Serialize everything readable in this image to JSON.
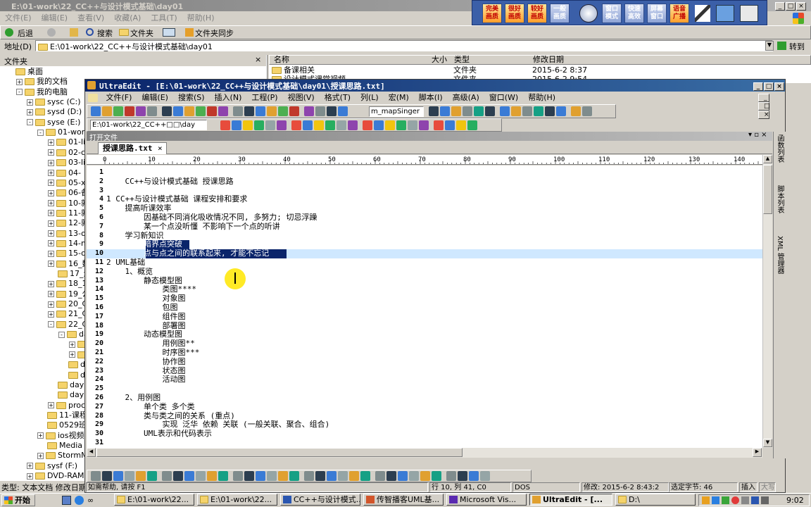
{
  "explorer": {
    "title": "E:\\01-work\\22_CC++与设计模式基础\\day01",
    "menu": [
      "文件(E)",
      "编辑(E)",
      "查看(V)",
      "收藏(A)",
      "工具(T)",
      "帮助(H)"
    ],
    "toolbar": {
      "back": "后退",
      "search": "搜索",
      "folders": "文件夹",
      "sync": "文件夹同步"
    },
    "address_label": "地址(D)",
    "address_value": "E:\\01-work\\22_CC++与设计模式基础\\day01",
    "go_label": "转到",
    "pane_title": "文件夹",
    "tree": [
      {
        "label": "桌面",
        "indent": 0,
        "exp": ""
      },
      {
        "label": "我的文档",
        "indent": 1,
        "exp": "+"
      },
      {
        "label": "我的电脑",
        "indent": 1,
        "exp": "-"
      },
      {
        "label": "sysc (C:)",
        "indent": 2,
        "exp": "+"
      },
      {
        "label": "sysd (D:)",
        "indent": 2,
        "exp": "+"
      },
      {
        "label": "syse (E:)",
        "indent": 2,
        "exp": "-"
      },
      {
        "label": "01-work",
        "indent": 3,
        "exp": "-"
      },
      {
        "label": "01-lin",
        "indent": 4,
        "exp": "+"
      },
      {
        "label": "02-c课",
        "indent": 4,
        "exp": "+"
      },
      {
        "label": "03-lin",
        "indent": 4,
        "exp": "+"
      },
      {
        "label": "04-",
        "indent": 4,
        "exp": "+"
      },
      {
        "label": "05-xun",
        "indent": 4,
        "exp": "+"
      },
      {
        "label": "06-备语",
        "indent": 4,
        "exp": "+"
      },
      {
        "label": "10-就业",
        "indent": 4,
        "exp": "+"
      },
      {
        "label": "11-就业",
        "indent": 4,
        "exp": "+"
      },
      {
        "label": "12-就业",
        "indent": 4,
        "exp": "+"
      },
      {
        "label": "13-otb",
        "indent": 4,
        "exp": "+"
      },
      {
        "label": "14-mys",
        "indent": 4,
        "exp": "+"
      },
      {
        "label": "15-ora",
        "indent": 4,
        "exp": "+"
      },
      {
        "label": "16_数据",
        "indent": 4,
        "exp": "+"
      },
      {
        "label": "17_演补",
        "indent": 4,
        "exp": ""
      },
      {
        "label": "18_111",
        "indent": 4,
        "exp": "+"
      },
      {
        "label": "19_公开",
        "indent": 4,
        "exp": "+"
      },
      {
        "label": "20_C提",
        "indent": 4,
        "exp": "+"
      },
      {
        "label": "21_CPl",
        "indent": 4,
        "exp": "+"
      },
      {
        "label": "22_CC+",
        "indent": 4,
        "exp": "-"
      },
      {
        "label": "day",
        "indent": 5,
        "exp": "-"
      },
      {
        "label": "",
        "indent": 6,
        "exp": "+"
      },
      {
        "label": "",
        "indent": 6,
        "exp": "+"
      },
      {
        "label": "day",
        "indent": 5,
        "exp": ""
      },
      {
        "label": "day",
        "indent": 5,
        "exp": ""
      },
      {
        "label": "day08",
        "indent": 4,
        "exp": ""
      },
      {
        "label": "day11",
        "indent": 4,
        "exp": ""
      },
      {
        "label": "proc网",
        "indent": 4,
        "exp": "+"
      },
      {
        "label": "11-课程框",
        "indent": 3,
        "exp": ""
      },
      {
        "label": "0529班",
        "indent": 3,
        "exp": ""
      },
      {
        "label": "ios视频",
        "indent": 3,
        "exp": "+"
      },
      {
        "label": "Media",
        "indent": 3,
        "exp": ""
      },
      {
        "label": "StormMedi",
        "indent": 3,
        "exp": "+"
      },
      {
        "label": "sysf (F:)",
        "indent": 2,
        "exp": "+"
      },
      {
        "label": "DVD-RAM 驱动",
        "indent": 2,
        "exp": "+"
      }
    ],
    "list_headers": [
      "名称",
      "大小",
      "类型",
      "修改日期"
    ],
    "list_rows": [
      {
        "name": "备课相关",
        "size": "",
        "type": "文件夹",
        "date": "2015-6-2 8:37"
      },
      {
        "name": "设计模式课堂视频",
        "size": "",
        "type": "文件夹",
        "date": "2015-6-2 9:54"
      }
    ],
    "status_left": "类型: 文本文档 修改日期"
  },
  "quick_launch": [
    {
      "label": "完美\n画质"
    },
    {
      "label": "很好\n画质"
    },
    {
      "label": "较好\n画质"
    },
    {
      "label": "一般\n画质"
    },
    {
      "label": "窗口\n模式"
    },
    {
      "label": "快速\n高效"
    },
    {
      "label": "屏幕\n窗口"
    },
    {
      "label": "语音\n广播"
    }
  ],
  "ultraedit": {
    "title": "UltraEdit - [E:\\01-work\\22_CC++与设计模式基础\\day01\\授课思路.txt]",
    "menu": [
      "文件(F)",
      "编辑(E)",
      "搜索(S)",
      "插入(N)",
      "工程(P)",
      "视图(V)",
      "格式(T)",
      "列(L)",
      "宏(M)",
      "脚本(I)",
      "高级(A)",
      "窗口(W)",
      "帮助(H)"
    ],
    "macro_combo": "m_mapSinger",
    "path_combo": "E:\\01-work\\22_CC++\u0000\u0000\\day",
    "open_files_label": "打开文件",
    "tab_label": "授课思路.txt",
    "ruler_ticks": [
      "0",
      "10",
      "20",
      "30",
      "40",
      "50",
      "60",
      "70",
      "80",
      "90",
      "100",
      "110",
      "120",
      "130",
      "140"
    ],
    "lines": [
      {
        "n": "1",
        "text": ""
      },
      {
        "n": "2",
        "text": "    CC++与设计模式基础 授课思路"
      },
      {
        "n": "3",
        "text": ""
      },
      {
        "n": "4",
        "text": "1 CC++与设计模式基础 课程安排和要求"
      },
      {
        "n": "5",
        "text": "    提高听课效率"
      },
      {
        "n": "6",
        "text": "        因基础不同消化吸收情况不同, 多努力; 切忌浮躁"
      },
      {
        "n": "7",
        "text": "        某一个点没听懂 不影响下一个点的听讲"
      },
      {
        "n": "8",
        "text": "    学习新知识"
      },
      {
        "n": "9",
        "text": "        暗界点突破"
      },
      {
        "n": "10",
        "text": "        点与点之间的联系起来, 才能不忘记"
      },
      {
        "n": "11",
        "text": "2 UML基础"
      },
      {
        "n": "12",
        "text": "    1、概览"
      },
      {
        "n": "13",
        "text": "        静态模型图"
      },
      {
        "n": "14",
        "text": "            类图****"
      },
      {
        "n": "15",
        "text": "            对象图"
      },
      {
        "n": "16",
        "text": "            包图"
      },
      {
        "n": "17",
        "text": "            组件图"
      },
      {
        "n": "18",
        "text": "            部署图"
      },
      {
        "n": "19",
        "text": "        动态模型图"
      },
      {
        "n": "20",
        "text": "            用例图**"
      },
      {
        "n": "21",
        "text": "            时序图***"
      },
      {
        "n": "22",
        "text": "            协作图"
      },
      {
        "n": "23",
        "text": "            状态图"
      },
      {
        "n": "24",
        "text": "            活动图"
      },
      {
        "n": "25",
        "text": ""
      },
      {
        "n": "26",
        "text": "    2、用例图"
      },
      {
        "n": "27",
        "text": "        单个类 多个类"
      },
      {
        "n": "28",
        "text": "        类与类之间的关系 (重点)"
      },
      {
        "n": "29",
        "text": "            实现 泛华 依赖 关联 (一般关联、聚合、组合)"
      },
      {
        "n": "30",
        "text": "        UML表示和代码表示"
      },
      {
        "n": "31",
        "text": ""
      }
    ],
    "side_tabs": [
      "函数列表",
      "脚本列表",
      "XML 管理器"
    ],
    "status_help": "如需帮助, 请按 F1",
    "status_pos": "行 10, 列 41, C0",
    "status_dos": "DOS",
    "status_modified": "修改: 2015-6-2 8:43:2",
    "status_selected": "选定字节: 46",
    "status_insert": "插入",
    "status_caps": "大写"
  },
  "taskbar": {
    "start": "开始",
    "items": [
      {
        "label": "E:\\01-work\\22..."
      },
      {
        "label": "E:\\01-work\\22..."
      },
      {
        "label": "CC++与设计模式..."
      },
      {
        "label": "传智播客UML基..."
      },
      {
        "label": "Microsoft Vis..."
      },
      {
        "label": "UltraEdit - [..."
      },
      {
        "label": "D:\\"
      }
    ],
    "clock": "9:02"
  }
}
